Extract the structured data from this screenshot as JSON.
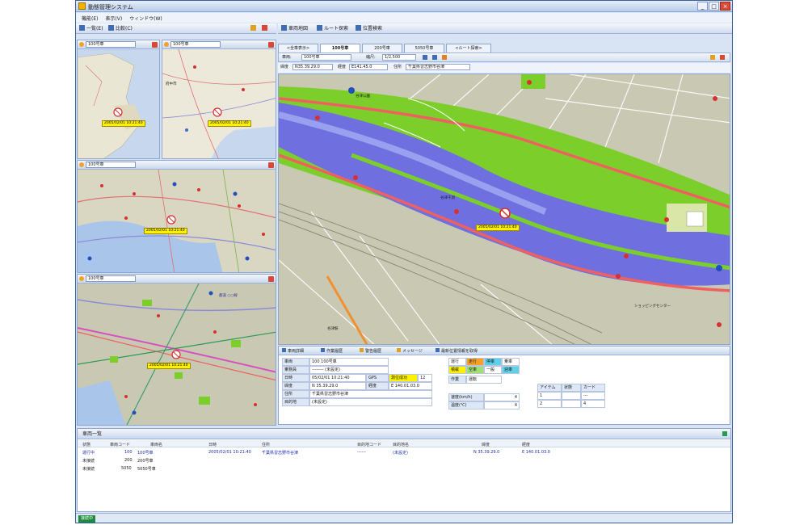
{
  "window": {
    "title": "動態管理システム",
    "min": "_",
    "max": "□",
    "close": "×"
  },
  "menu": [
    "機能(E)",
    "表示(V)",
    "ウィンドウ(W)"
  ],
  "left_toolbar": {
    "list_button": "一覧(E)",
    "compare_button": "比較(C)"
  },
  "right_toolbar": {
    "btn1": "車両地図",
    "btn2": "ルート探索",
    "btn3": "位置検索"
  },
  "mini_maps": [
    {
      "vehicle": "100号車",
      "tag": "2005/02/01 10:21:40"
    },
    {
      "vehicle": "100号車",
      "tag": "2005/02/01 10:21:40",
      "place_label": "府中市"
    },
    {
      "vehicle": "100号車",
      "tag": "2005/02/01 10:21:40"
    },
    {
      "vehicle": "100号車",
      "tag": "2005/02/01 10:21:40",
      "road_label": "都道 ○○線"
    }
  ],
  "tabs": [
    "<全車表示>",
    "100号車",
    "200号車",
    "5050号車",
    "<ルート探索>"
  ],
  "main_map_toolbar": {
    "vehicle_label": "車両:",
    "vehicle": "100号車",
    "zoom_label": "縮尺:",
    "zoom": "1/2,500"
  },
  "coords": {
    "lat_label": "緯度",
    "lat": "N35.39.29.0",
    "lon_label": "経度",
    "lon": "E141.45.0",
    "addr_label": "住所",
    "addr": "千葉県習志野市谷津"
  },
  "main_map": {
    "tag": "2005/02/01 10:21:40",
    "label_1": "谷津干潟",
    "label_2": "谷津公園",
    "label_3": "ショッピングセンター",
    "label_4": "谷津駅"
  },
  "detail_tabs": [
    "車両詳細",
    "作業履歴",
    "警告履歴",
    "メッセージ",
    "最新位置情報を取得"
  ],
  "detail": {
    "vehicle_label": "車両",
    "vehicle_value": "100 100号車",
    "driver_label": "乗務員",
    "driver_value": "-------- (未設定)",
    "datetime_label": "日時",
    "datetime_value": "05/02/01 10:21:40",
    "gps_label": "GPS",
    "gps_value": "測位成功",
    "gps_count": "12",
    "lat_label": "緯度",
    "lat_value": "N 35.39.29.0",
    "lon_label": "経度",
    "lon_value": "E 140.01.03.0",
    "addr_label": "住所",
    "addr_value": "千葉県習志野市谷津",
    "dest_label": "目的地",
    "dest_value": "(未設定)",
    "status": [
      "運行",
      "走行",
      "停車",
      "乗車",
      "積載",
      "空車",
      "一般",
      "迎車"
    ],
    "work_label": "作業",
    "work_value": "運転",
    "speed_label": "速度(km/h)",
    "speed_value": "4",
    "temp_label": "温度(℃)",
    "temp_value": "4",
    "grid_h": [
      "アイテム",
      "状態",
      "カード"
    ],
    "grid_rows": [
      [
        "1",
        "",
        "---"
      ],
      [
        "2",
        "",
        "4"
      ]
    ]
  },
  "list": {
    "title": "車両一覧",
    "headers": [
      "状態",
      "車両コード",
      "車両名",
      "日時",
      "住所",
      "目的地コード",
      "目的地名",
      "緯度",
      "経度"
    ],
    "rows": [
      [
        "運行中",
        "100",
        "100号車",
        "2005/02/01 10:21:40",
        "千葉県習志野市谷津",
        "------",
        "(未設定)",
        "N 35.39.29.0",
        "E 140.01.03.0"
      ],
      [
        "未接続",
        "200",
        "200号車",
        "",
        "",
        "",
        "",
        "",
        ""
      ],
      [
        "未接続",
        "5050",
        "5050号車",
        "",
        "",
        "",
        "",
        "",
        ""
      ]
    ]
  },
  "status_bar": "接続中",
  "colors": {
    "water": "#6f6fe0",
    "park": "#7ccf2a",
    "road_red": "#ef6060",
    "land": "#c9c8b3",
    "tag": "#fff200",
    "window": "#d8e4f4"
  }
}
